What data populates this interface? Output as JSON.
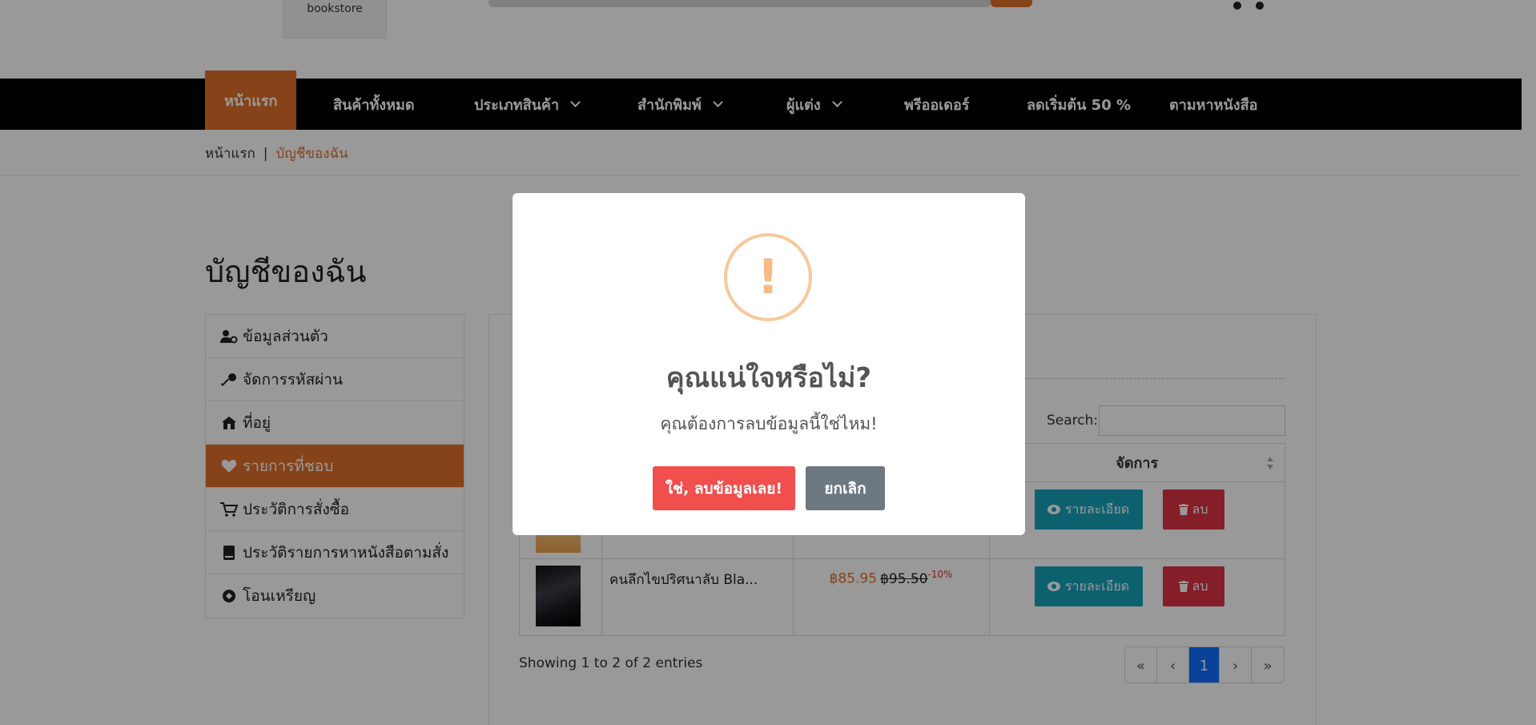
{
  "header": {
    "logo_text": "bookstore"
  },
  "nav": {
    "items": [
      {
        "label": "หน้าแรก"
      },
      {
        "label": "สินค้าทั้งหมด"
      },
      {
        "label": "ประเภทสินค้า"
      },
      {
        "label": "สำนักพิมพ์"
      },
      {
        "label": "ผู้แต่ง"
      },
      {
        "label": "พรีออเดอร์"
      },
      {
        "label": "ลดเริ่มต้น 50 %"
      },
      {
        "label": "ตามหาหนังสือ"
      }
    ]
  },
  "breadcrumb": {
    "home": "หน้าแรก",
    "separator": "|",
    "current": "บัญชีของฉัน"
  },
  "account": {
    "title": "บัญชีของฉัน",
    "menu": [
      {
        "label": "ข้อมูลส่วนตัว",
        "icon": "user-gear-icon"
      },
      {
        "label": "จัดการรหัสผ่าน",
        "icon": "key-icon"
      },
      {
        "label": "ที่อยู่",
        "icon": "house-icon"
      },
      {
        "label": "รายการที่ชอบ",
        "icon": "heart-icon"
      },
      {
        "label": "ประวัติการสั่งซื้อ",
        "icon": "cart-icon"
      },
      {
        "label": "ประวัติรายการหาหนังสือตามสั่ง",
        "icon": "book-icon"
      },
      {
        "label": "โอนเหรียญ",
        "icon": "coin-icon"
      }
    ]
  },
  "table": {
    "search_label": "Search:",
    "header_action": "จัดการ",
    "rows": [
      {
        "name": "",
        "price_new": "",
        "price_old": "",
        "discount": "",
        "detail_label": "รายละเอียด",
        "delete_label": "ลบ"
      },
      {
        "name": "คนลึกไขปริศนาลับ Bla...",
        "price_new": "฿85.95",
        "price_old": "฿95.50",
        "discount": "-10%",
        "detail_label": "รายละเอียด",
        "delete_label": "ลบ"
      }
    ],
    "entries_info": "Showing 1 to 2 of 2 entries",
    "pagination": [
      "«",
      "‹",
      "1",
      "›",
      "»"
    ]
  },
  "modal": {
    "icon_glyph": "!",
    "title": "คุณแน่ใจหรือไม่?",
    "text": "คุณต้องการลบข้อมูลนี้ใช่ไหม!",
    "confirm_label": "ใช่, ลบข้อมูลเลย!",
    "cancel_label": "ยกเลิก"
  },
  "colors": {
    "accent": "#e0702a",
    "danger": "#dc3545",
    "info": "#17a2b8",
    "warning_icon": "#f8bb86",
    "modal_confirm": "#f14e4e",
    "modal_cancel": "#6e7881",
    "pager_active": "#0d6efd"
  }
}
